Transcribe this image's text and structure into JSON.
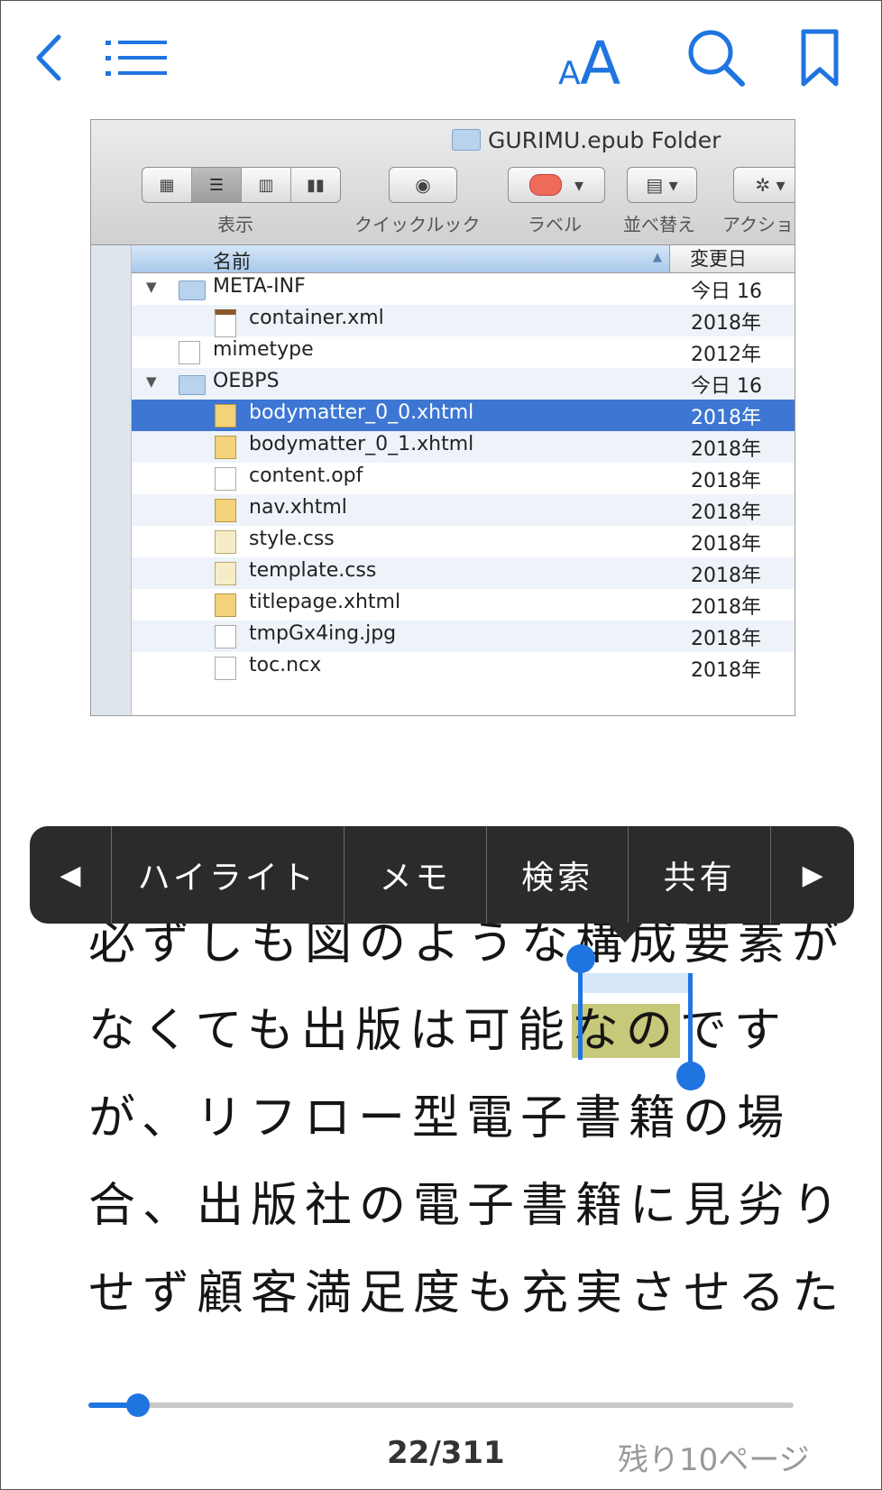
{
  "toolbar": {
    "font_label": "AA"
  },
  "finder": {
    "title": "GURIMU.epub Folder",
    "view_label": "表示",
    "quicklook_label": "クイックルック",
    "label_label": "ラベル",
    "sort_label": "並べ替え",
    "action_label": "アクショ",
    "col_name": "名前",
    "col_date": "変更日",
    "rows": [
      {
        "name": "META-INF",
        "date": "今日 16",
        "kind": "folder",
        "indent": 0,
        "expanded": true,
        "selected": false
      },
      {
        "name": "container.xml",
        "date": "2018年",
        "kind": "xml",
        "indent": 1,
        "selected": false
      },
      {
        "name": "mimetype",
        "date": "2012年",
        "kind": "file",
        "indent": 0,
        "selected": false
      },
      {
        "name": "OEBPS",
        "date": "今日 16",
        "kind": "folder",
        "indent": 0,
        "expanded": true,
        "selected": false
      },
      {
        "name": "bodymatter_0_0.xhtml",
        "date": "2018年",
        "kind": "xhtml",
        "indent": 1,
        "selected": true
      },
      {
        "name": "bodymatter_0_1.xhtml",
        "date": "2018年",
        "kind": "xhtml",
        "indent": 1,
        "selected": false
      },
      {
        "name": "content.opf",
        "date": "2018年",
        "kind": "file",
        "indent": 1,
        "selected": false
      },
      {
        "name": "nav.xhtml",
        "date": "2018年",
        "kind": "xhtml",
        "indent": 1,
        "selected": false
      },
      {
        "name": "style.css",
        "date": "2018年",
        "kind": "css",
        "indent": 1,
        "selected": false
      },
      {
        "name": "template.css",
        "date": "2018年",
        "kind": "css",
        "indent": 1,
        "selected": false
      },
      {
        "name": "titlepage.xhtml",
        "date": "2018年",
        "kind": "xhtml",
        "indent": 1,
        "selected": false
      },
      {
        "name": "tmpGx4ing.jpg",
        "date": "2018年",
        "kind": "file",
        "indent": 1,
        "selected": false
      },
      {
        "name": "toc.ncx",
        "date": "2018年",
        "kind": "file",
        "indent": 1,
        "selected": false
      }
    ]
  },
  "menu": {
    "prev": "◀",
    "highlight": "ハイライト",
    "memo": "メモ",
    "search": "検索",
    "share": "共有",
    "next": "▶"
  },
  "text": {
    "line1": "必ずしも図のような構成要素が",
    "line2_a": "なくても出版は可能",
    "line2_sel": "なの",
    "line2_b": "です",
    "line3": "が、リフロー型電子書籍の場",
    "line4": "合、出版社の電子書籍に見劣り",
    "line5": "せず顧客満足度も充実させるた"
  },
  "progress": {
    "page_current": 22,
    "page_total": 311,
    "fraction": 0.07,
    "page_label": "22/311",
    "remaining": "残り10ページ"
  },
  "colors": {
    "accent": "#1f75e0",
    "highlight": "#c7c97a",
    "menu_bg": "#2b2b2b",
    "finder_selection": "#3d76d3"
  }
}
